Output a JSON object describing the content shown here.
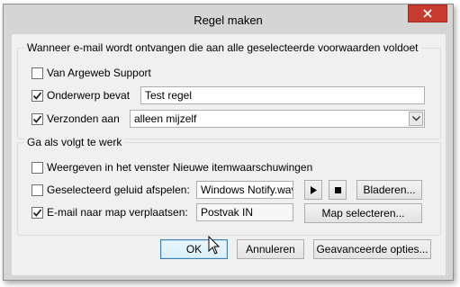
{
  "window": {
    "title": "Regel maken"
  },
  "conditions": {
    "legend": "Wanneer e-mail wordt ontvangen die aan alle geselecteerde voorwaarden voldoet",
    "from": {
      "label": "Van Argeweb Support",
      "checked": false
    },
    "subject": {
      "label": "Onderwerp bevat",
      "checked": true,
      "value": "Test regel"
    },
    "sent_to": {
      "label": "Verzonden aan",
      "checked": true,
      "value": "alleen mijzelf"
    }
  },
  "actions": {
    "legend": "Ga als volgt te werk",
    "show_alert": {
      "label": "Weergeven in het venster Nieuwe itemwaarschuwingen",
      "checked": false
    },
    "play_sound": {
      "label": "Geselecteerd geluid afspelen:",
      "checked": false,
      "value": "Windows Notify.wav",
      "browse_label": "Bladeren..."
    },
    "move_to_folder": {
      "label": "E-mail naar map verplaatsen:",
      "checked": true,
      "value": "Postvak IN",
      "select_label": "Map selecteren..."
    }
  },
  "footer": {
    "ok_label": "OK",
    "cancel_label": "Annuleren",
    "advanced_label": "Geavanceerde opties..."
  },
  "colors": {
    "close_button": "#c73a2e",
    "dialog_bg": "#f0f0f0",
    "frame": "#d5d5d5"
  }
}
